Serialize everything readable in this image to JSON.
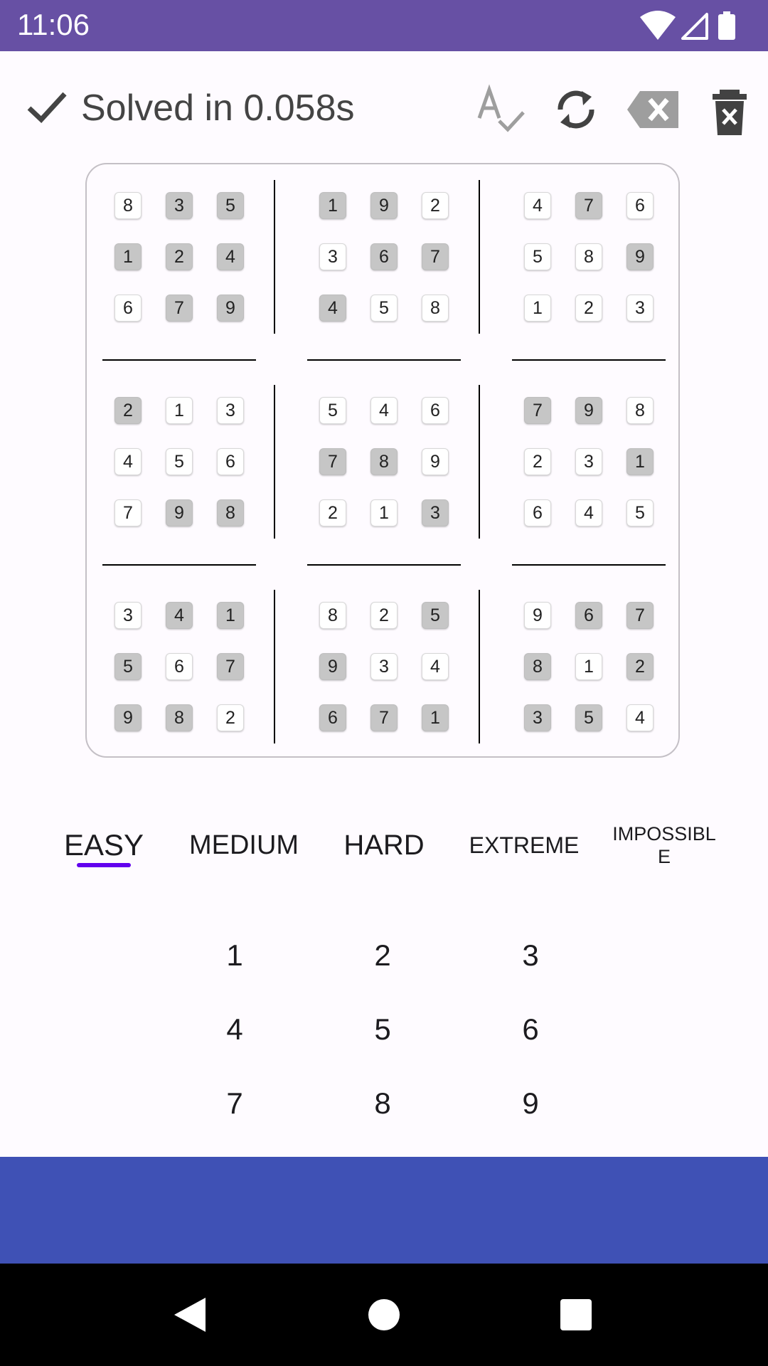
{
  "status_bar": {
    "time": "11:06",
    "icons": [
      "wifi-icon",
      "cell-signal-icon",
      "battery-icon"
    ]
  },
  "toolbar": {
    "status_icon": "check-icon",
    "status_text": "Solved in 0.058s",
    "actions": [
      "spell-check-icon",
      "refresh-icon",
      "backspace-icon",
      "delete-icon"
    ]
  },
  "board": {
    "rows": [
      [
        "8",
        "3",
        "5",
        "1",
        "9",
        "2",
        "4",
        "7",
        "6"
      ],
      [
        "1",
        "2",
        "4",
        "3",
        "6",
        "7",
        "5",
        "8",
        "9"
      ],
      [
        "6",
        "7",
        "9",
        "4",
        "5",
        "8",
        "1",
        "2",
        "3"
      ],
      [
        "2",
        "1",
        "3",
        "5",
        "4",
        "6",
        "7",
        "9",
        "8"
      ],
      [
        "4",
        "5",
        "6",
        "7",
        "8",
        "9",
        "2",
        "3",
        "1"
      ],
      [
        "7",
        "9",
        "8",
        "2",
        "1",
        "3",
        "6",
        "4",
        "5"
      ],
      [
        "3",
        "4",
        "1",
        "8",
        "2",
        "5",
        "9",
        "6",
        "7"
      ],
      [
        "5",
        "6",
        "7",
        "9",
        "3",
        "4",
        "8",
        "1",
        "2"
      ],
      [
        "9",
        "8",
        "2",
        "6",
        "7",
        "1",
        "3",
        "5",
        "4"
      ]
    ],
    "given": [
      [
        0,
        1,
        1,
        1,
        1,
        0,
        0,
        1,
        0
      ],
      [
        1,
        1,
        1,
        0,
        1,
        1,
        0,
        0,
        1
      ],
      [
        0,
        1,
        1,
        1,
        0,
        0,
        0,
        0,
        0
      ],
      [
        1,
        0,
        0,
        0,
        0,
        0,
        1,
        1,
        0
      ],
      [
        0,
        0,
        0,
        1,
        1,
        0,
        0,
        0,
        1
      ],
      [
        0,
        1,
        1,
        0,
        0,
        1,
        0,
        0,
        0
      ],
      [
        0,
        1,
        1,
        0,
        0,
        1,
        0,
        1,
        1
      ],
      [
        1,
        0,
        1,
        1,
        0,
        0,
        1,
        0,
        1
      ],
      [
        1,
        1,
        0,
        1,
        1,
        1,
        1,
        1,
        0
      ]
    ]
  },
  "difficulty": {
    "tabs": [
      {
        "id": "easy",
        "label": "EASY"
      },
      {
        "id": "medium",
        "label": "MEDIUM"
      },
      {
        "id": "hard",
        "label": "HARD"
      },
      {
        "id": "extreme",
        "label": "EXTREME"
      },
      {
        "id": "impossible",
        "label": "IMPOSSIBL E"
      }
    ],
    "selected": "EASY"
  },
  "keypad": {
    "keys": [
      "1",
      "2",
      "3",
      "4",
      "5",
      "6",
      "7",
      "8",
      "9"
    ]
  },
  "nav_bar": {
    "buttons": [
      "back-icon",
      "home-icon",
      "recents-icon"
    ]
  },
  "colors": {
    "status_bar": "#6750a4",
    "bottom_band": "#3f51b5",
    "tab_indicator": "#6200ee",
    "given_cell": "#c6c6c6"
  }
}
